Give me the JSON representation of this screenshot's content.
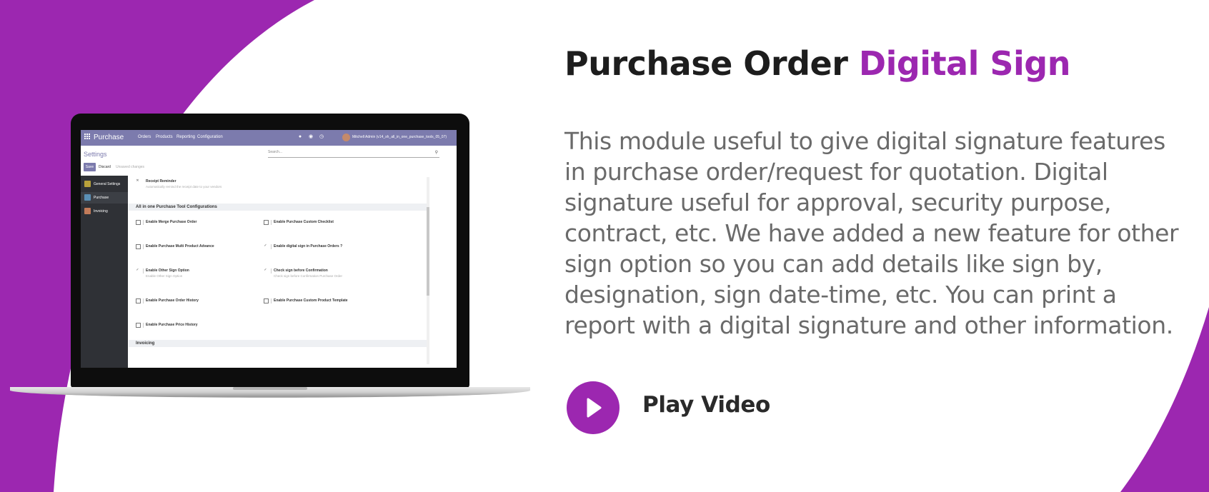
{
  "colors": {
    "accent": "#9c27b0",
    "heading": "#1d1d1d",
    "body_text": "#6a6a6a",
    "odoo_purple": "#7c7bad"
  },
  "headline": {
    "part1": "Purchase Order ",
    "accent": "Digital Sign"
  },
  "description": "This module useful to give digital signature features in purchase order/request for quotation. Digital signature useful for approval, security purpose, contract, etc. We have added a new feature for other sign option so you can add details like sign by, designation, sign date-time, etc. You can print a report with a digital signature and other information.",
  "play": {
    "label": "Play Video",
    "icon": "play-icon"
  },
  "screen": {
    "app_name": "Purchase",
    "menus": [
      "Orders",
      "Products",
      "Reporting",
      "Configuration"
    ],
    "user": "Mitchell Admin (v14_sh_all_in_one_purchase_tools_05_07)",
    "page_title": "Settings",
    "search_placeholder": "Search...",
    "save": "Save",
    "discard": "Discard",
    "unsaved": "Unsaved changes",
    "sidebar": [
      {
        "label": "General Settings",
        "icon": "settings-app-icon",
        "color": "#b8a13b"
      },
      {
        "label": "Purchase",
        "icon": "purchase-app-icon",
        "color": "#5a8fb4"
      },
      {
        "label": "Invoicing",
        "icon": "invoicing-app-icon",
        "color": "#c27b5a"
      }
    ],
    "receipt_reminder": {
      "label": "Receipt Reminder",
      "hint": "Automatically remind the receipt date to your vendors",
      "checked": true
    },
    "section_title": "All in one Purchase Tool Configurations",
    "settings": [
      {
        "label": "Enable Merge Purchase Order",
        "hint": "",
        "checked": false
      },
      {
        "label": "Enable Purchase Custom Checklist",
        "hint": "",
        "checked": false
      },
      {
        "label": "Enable Purchase Multi Product Advance",
        "hint": "",
        "checked": false
      },
      {
        "label": "Enable digital sign in Purchase Orders ?",
        "hint": "",
        "checked": true
      },
      {
        "label": "Enable Other Sign Option",
        "hint": "Enable Other Sign Option",
        "checked": true
      },
      {
        "label": "Check sign before Confirmation",
        "hint": "Check sign before Confirmation Purchase Order",
        "checked": true
      },
      {
        "label": "Enable Purchase Order History",
        "hint": "",
        "checked": false
      },
      {
        "label": "Enable Purchase Custom Product Template",
        "hint": "",
        "checked": false
      },
      {
        "label": "Enable Purchase Price History",
        "hint": "",
        "checked": false
      }
    ],
    "next_section": "Invoicing"
  }
}
